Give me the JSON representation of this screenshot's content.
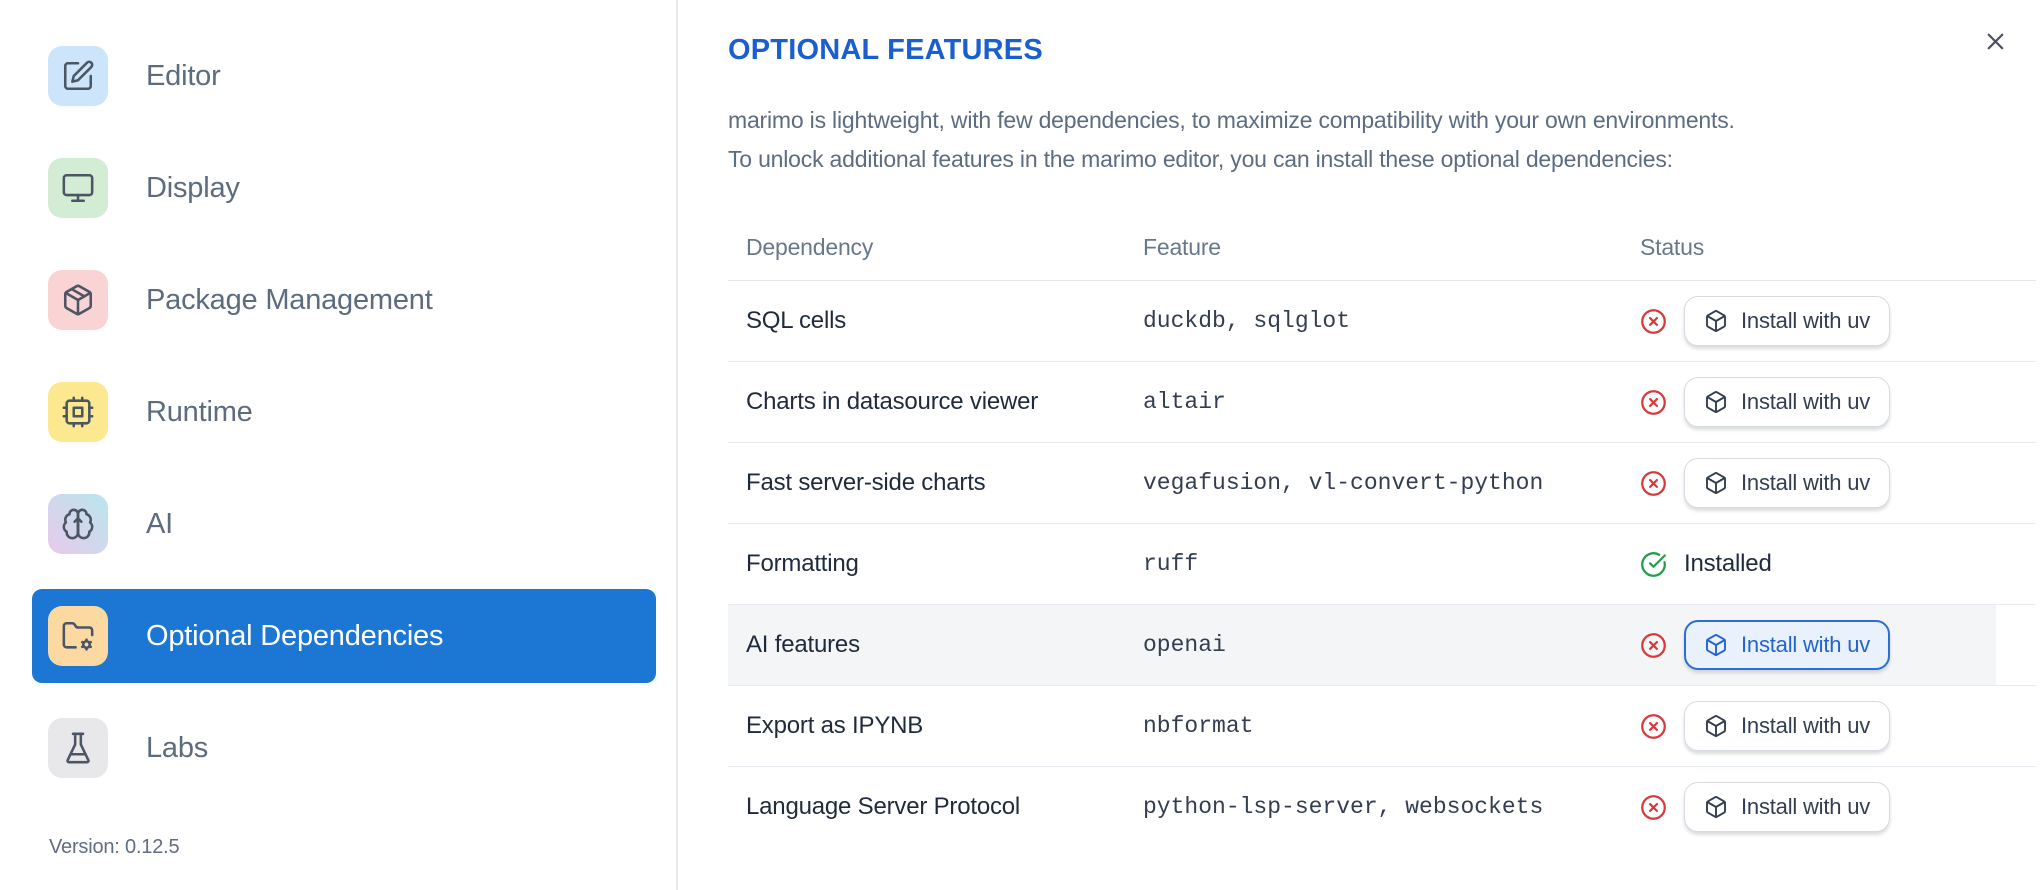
{
  "sidebar": {
    "items": [
      {
        "label": "Editor",
        "icon": "edit-icon",
        "tile_color": "#cde5fa",
        "selected": false
      },
      {
        "label": "Display",
        "icon": "monitor-icon",
        "tile_color": "#d3ecd4",
        "selected": false
      },
      {
        "label": "Package Management",
        "icon": "package-icon",
        "tile_color": "#fad3d5",
        "selected": false
      },
      {
        "label": "Runtime",
        "icon": "cpu-icon",
        "tile_color": "#fbe88f",
        "selected": false
      },
      {
        "label": "AI",
        "icon": "brain-icon",
        "tile_color": "#e8c9ec",
        "tile_color2": "#b9e6ef",
        "selected": false
      },
      {
        "label": "Optional Dependencies",
        "icon": "folder-gear-icon",
        "tile_color": "#fbd9a1",
        "selected": true
      },
      {
        "label": "Labs",
        "icon": "flask-icon",
        "tile_color": "#e8e8eb",
        "selected": false
      }
    ],
    "version": "Version: 0.12.5"
  },
  "panel": {
    "title": "OPTIONAL FEATURES",
    "description": [
      "marimo is lightweight, with few dependencies, to maximize compatibility with your own environments.",
      "To unlock additional features in the marimo editor, you can install these optional dependencies:"
    ]
  },
  "table": {
    "headers": [
      "Dependency",
      "Feature",
      "Status"
    ],
    "install_button_label": "Install with uv",
    "installed_label": "Installed",
    "rows": [
      {
        "dependency": "SQL cells",
        "feature": "duckdb, sqlglot",
        "installed": false,
        "highlighted": false
      },
      {
        "dependency": "Charts in datasource viewer",
        "feature": "altair",
        "installed": false,
        "highlighted": false
      },
      {
        "dependency": "Fast server-side charts",
        "feature": "vegafusion, vl-convert-python",
        "installed": false,
        "highlighted": false
      },
      {
        "dependency": "Formatting",
        "feature": "ruff",
        "installed": true,
        "highlighted": false
      },
      {
        "dependency": "AI features",
        "feature": "openai",
        "installed": false,
        "highlighted": true
      },
      {
        "dependency": "Export as IPYNB",
        "feature": "nbformat",
        "installed": false,
        "highlighted": false
      },
      {
        "dependency": "Language Server Protocol",
        "feature": "python-lsp-server, websockets",
        "installed": false,
        "highlighted": false
      }
    ]
  },
  "colors": {
    "selected_blue": "#1b76d4",
    "title_blue": "#1a5fd0",
    "focus_button_blue": "#2d6ed3",
    "error_red": "#d83a3c",
    "success_green": "#259c4d"
  }
}
